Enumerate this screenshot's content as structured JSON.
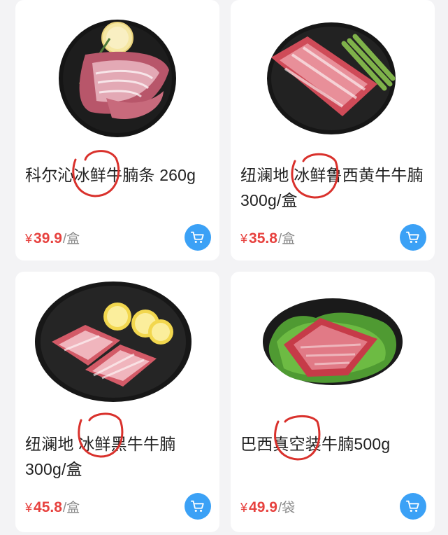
{
  "products": [
    {
      "title": "科尔沁冰鲜牛腩条 260g",
      "currency": "¥",
      "price": "39.9",
      "unit": "/盒",
      "image": "plate-beef-strips-lemon"
    },
    {
      "title": "纽澜地 冰鲜鲁西黄牛牛腩 300g/盒",
      "currency": "¥",
      "price": "35.8",
      "unit": "/盒",
      "image": "plate-beef-cubes-asparagus"
    },
    {
      "title": "纽澜地 冰鲜黑牛牛腩 300g/盒",
      "currency": "¥",
      "price": "45.8",
      "unit": "/盒",
      "image": "plate-beef-blocks-lemon"
    },
    {
      "title": "巴西真空装牛腩500g",
      "currency": "¥",
      "price": "49.9",
      "unit": "/袋",
      "image": "plate-beef-on-lettuce"
    }
  ],
  "icons": {
    "cart": "shopping-cart-icon"
  },
  "colors": {
    "price": "#e7423f",
    "cart_button": "#3ba1f6",
    "annotation": "#d9312c"
  }
}
